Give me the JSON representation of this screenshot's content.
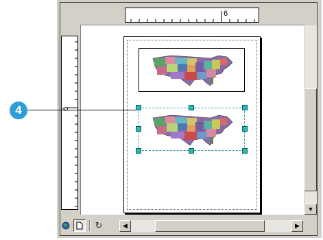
{
  "callout": {
    "number": "4"
  },
  "rulers": {
    "horizontal_label": "6",
    "vertical_label": "6"
  },
  "colors": {
    "handle": "#2fb3b3",
    "callout": "#2e9ed8",
    "selection": "#30a0a0"
  },
  "icons": {
    "data_view": "globe-icon",
    "layout_view": "page-icon",
    "refresh": "refresh-icon",
    "scroll_left": "arrow-left-icon",
    "scroll_right": "arrow-right-icon",
    "scroll_down": "arrow-down-icon"
  },
  "glyphs": {
    "left": "◀",
    "right": "▶",
    "down": "▼",
    "refresh": "↻"
  }
}
